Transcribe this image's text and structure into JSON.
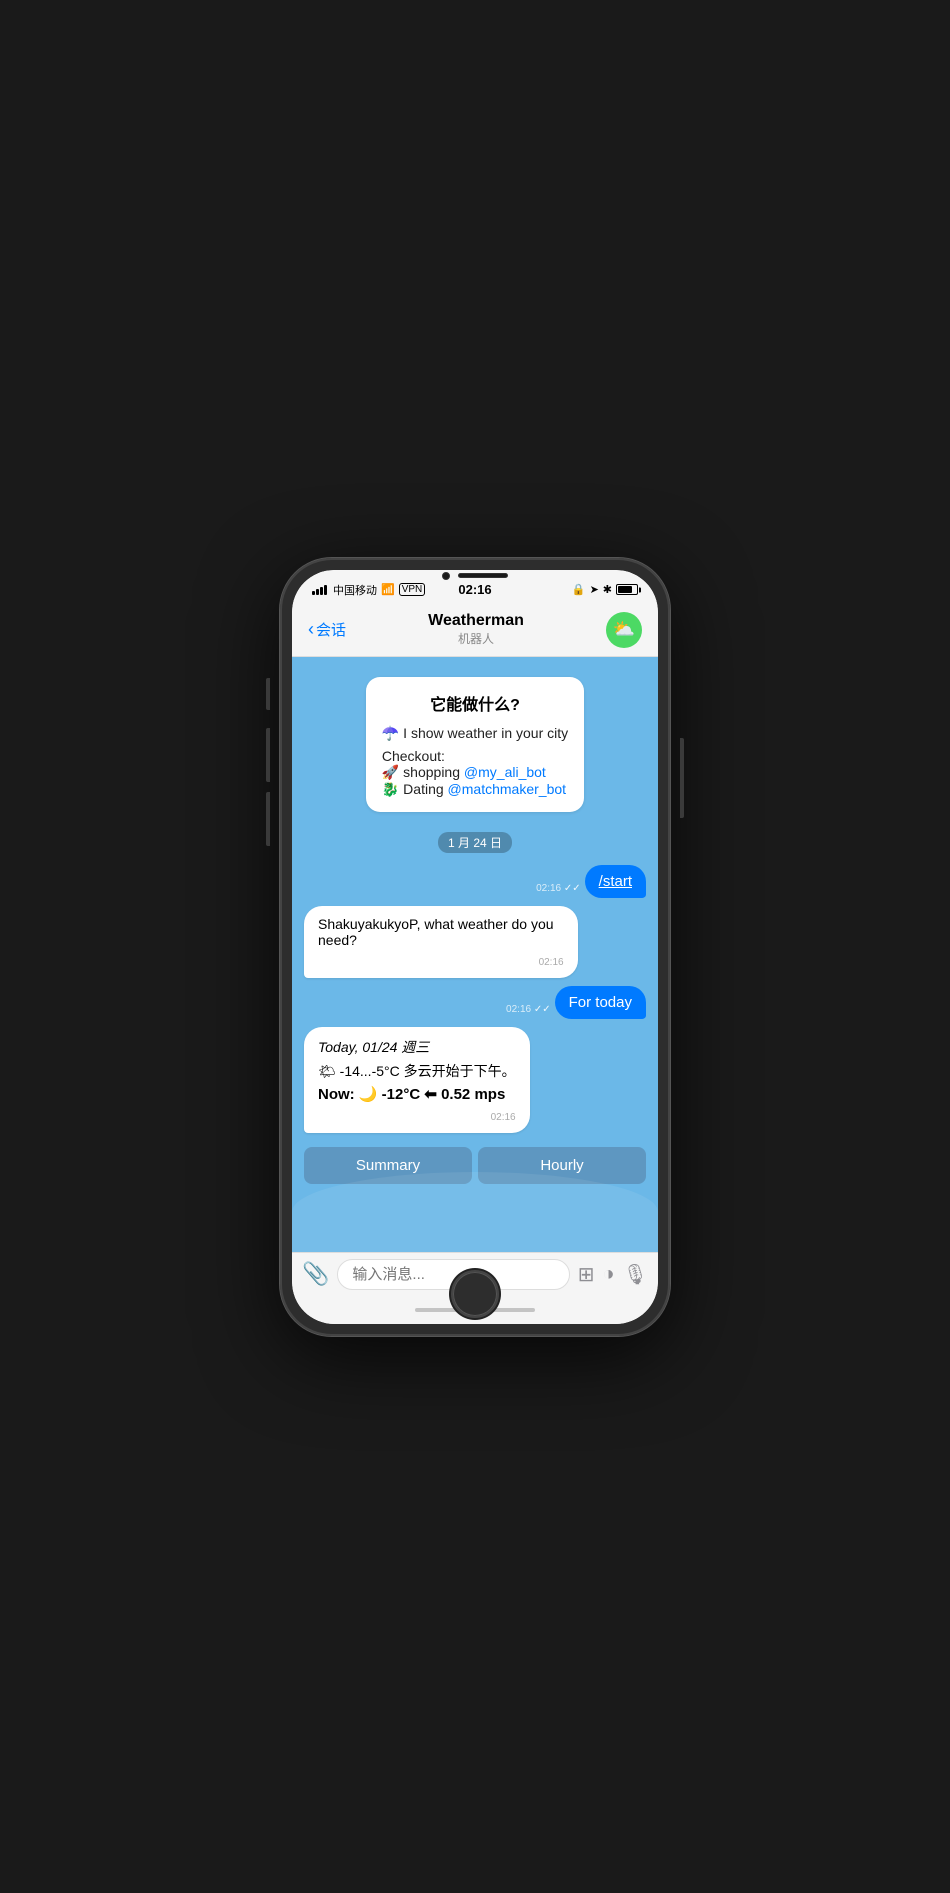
{
  "phone": {
    "status": {
      "carrier": "中国移动",
      "time": "02:16",
      "wifi": "wifi",
      "vpn": "VPN",
      "battery": "battery"
    },
    "nav": {
      "back_label": "会话",
      "title": "Weatherman",
      "subtitle": "机器人",
      "avatar_emoji": "⛅"
    },
    "chat": {
      "intro": {
        "title": "它能做什么?",
        "line1": "☂️ I show weather in your city",
        "checkout": "Checkout:",
        "link1_text": "@my_ali_bot",
        "link1_prefix": "🚀 shopping ",
        "link2_text": "@matchmaker_bot",
        "link2_prefix": "🐉 Dating "
      },
      "date_stamp": "1 月 24 日",
      "messages": [
        {
          "type": "user",
          "text": "/start",
          "time": "02:16",
          "ticks": "✓✓"
        },
        {
          "type": "bot",
          "text": "ShakuyakukyoP, what weather do you need?",
          "time": "02:16"
        },
        {
          "type": "user",
          "text": "For today",
          "time": "02:16",
          "ticks": "✓✓"
        },
        {
          "type": "bot",
          "date_line": "Today, 01/24 週三",
          "temp_line": "🌤 -14...-5°C 多云开始于下午。",
          "now_line": "Now: 🌙 -12°C ⬅ 0.52 mps",
          "time": "02:16"
        }
      ],
      "quick_replies": [
        {
          "label": "Summary"
        },
        {
          "label": "Hourly"
        }
      ]
    },
    "input": {
      "placeholder": "输入消息..."
    }
  }
}
